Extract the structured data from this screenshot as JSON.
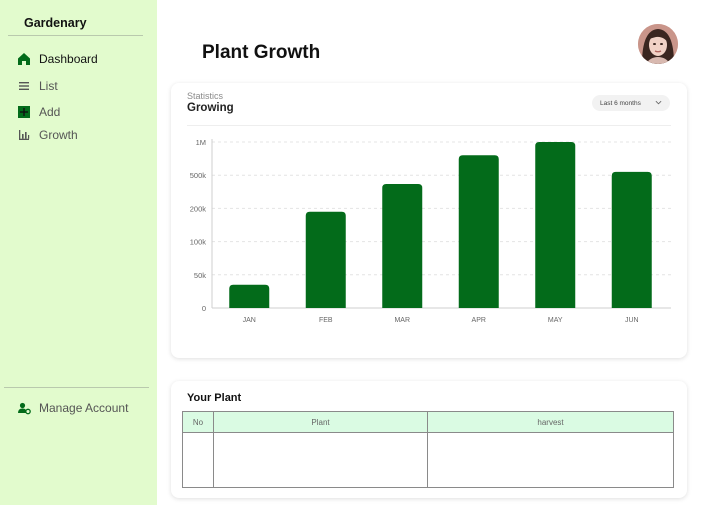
{
  "sidebar": {
    "brand": "Gardenary",
    "nav": [
      {
        "label": "Dashboard",
        "icon": "home-icon",
        "active": true
      },
      {
        "label": "List",
        "icon": "list-icon",
        "active": false
      },
      {
        "label": "Add",
        "icon": "add-icon",
        "active": false
      },
      {
        "label": "Growth",
        "icon": "bar-chart-icon",
        "active": false
      }
    ],
    "manage_account": {
      "label": "Manage Account",
      "icon": "user-settings-icon"
    }
  },
  "header": {
    "title": "Plant Growth",
    "avatar": "user-avatar"
  },
  "statistics": {
    "subtitle": "Statistics",
    "title": "Growing",
    "range_select": "Last 6 months"
  },
  "chart_data": {
    "type": "bar",
    "categories": [
      "JAN",
      "FEB",
      "MAR",
      "APR",
      "MAY",
      "JUN"
    ],
    "y_ticks": [
      "0",
      "50k",
      "100k",
      "200k",
      "500k",
      "1M"
    ],
    "values": [
      35000,
      190000,
      420000,
      800000,
      1000000,
      550000
    ],
    "grid": true,
    "bar_color": "#036b1a"
  },
  "your_plant": {
    "title": "Your Plant",
    "columns": [
      "No",
      "Plant",
      "harvest"
    ],
    "rows": []
  },
  "colors": {
    "sidebar_bg": "#e2fbcd",
    "accent_green": "#036b1a",
    "table_header_bg": "#dafbe3"
  }
}
